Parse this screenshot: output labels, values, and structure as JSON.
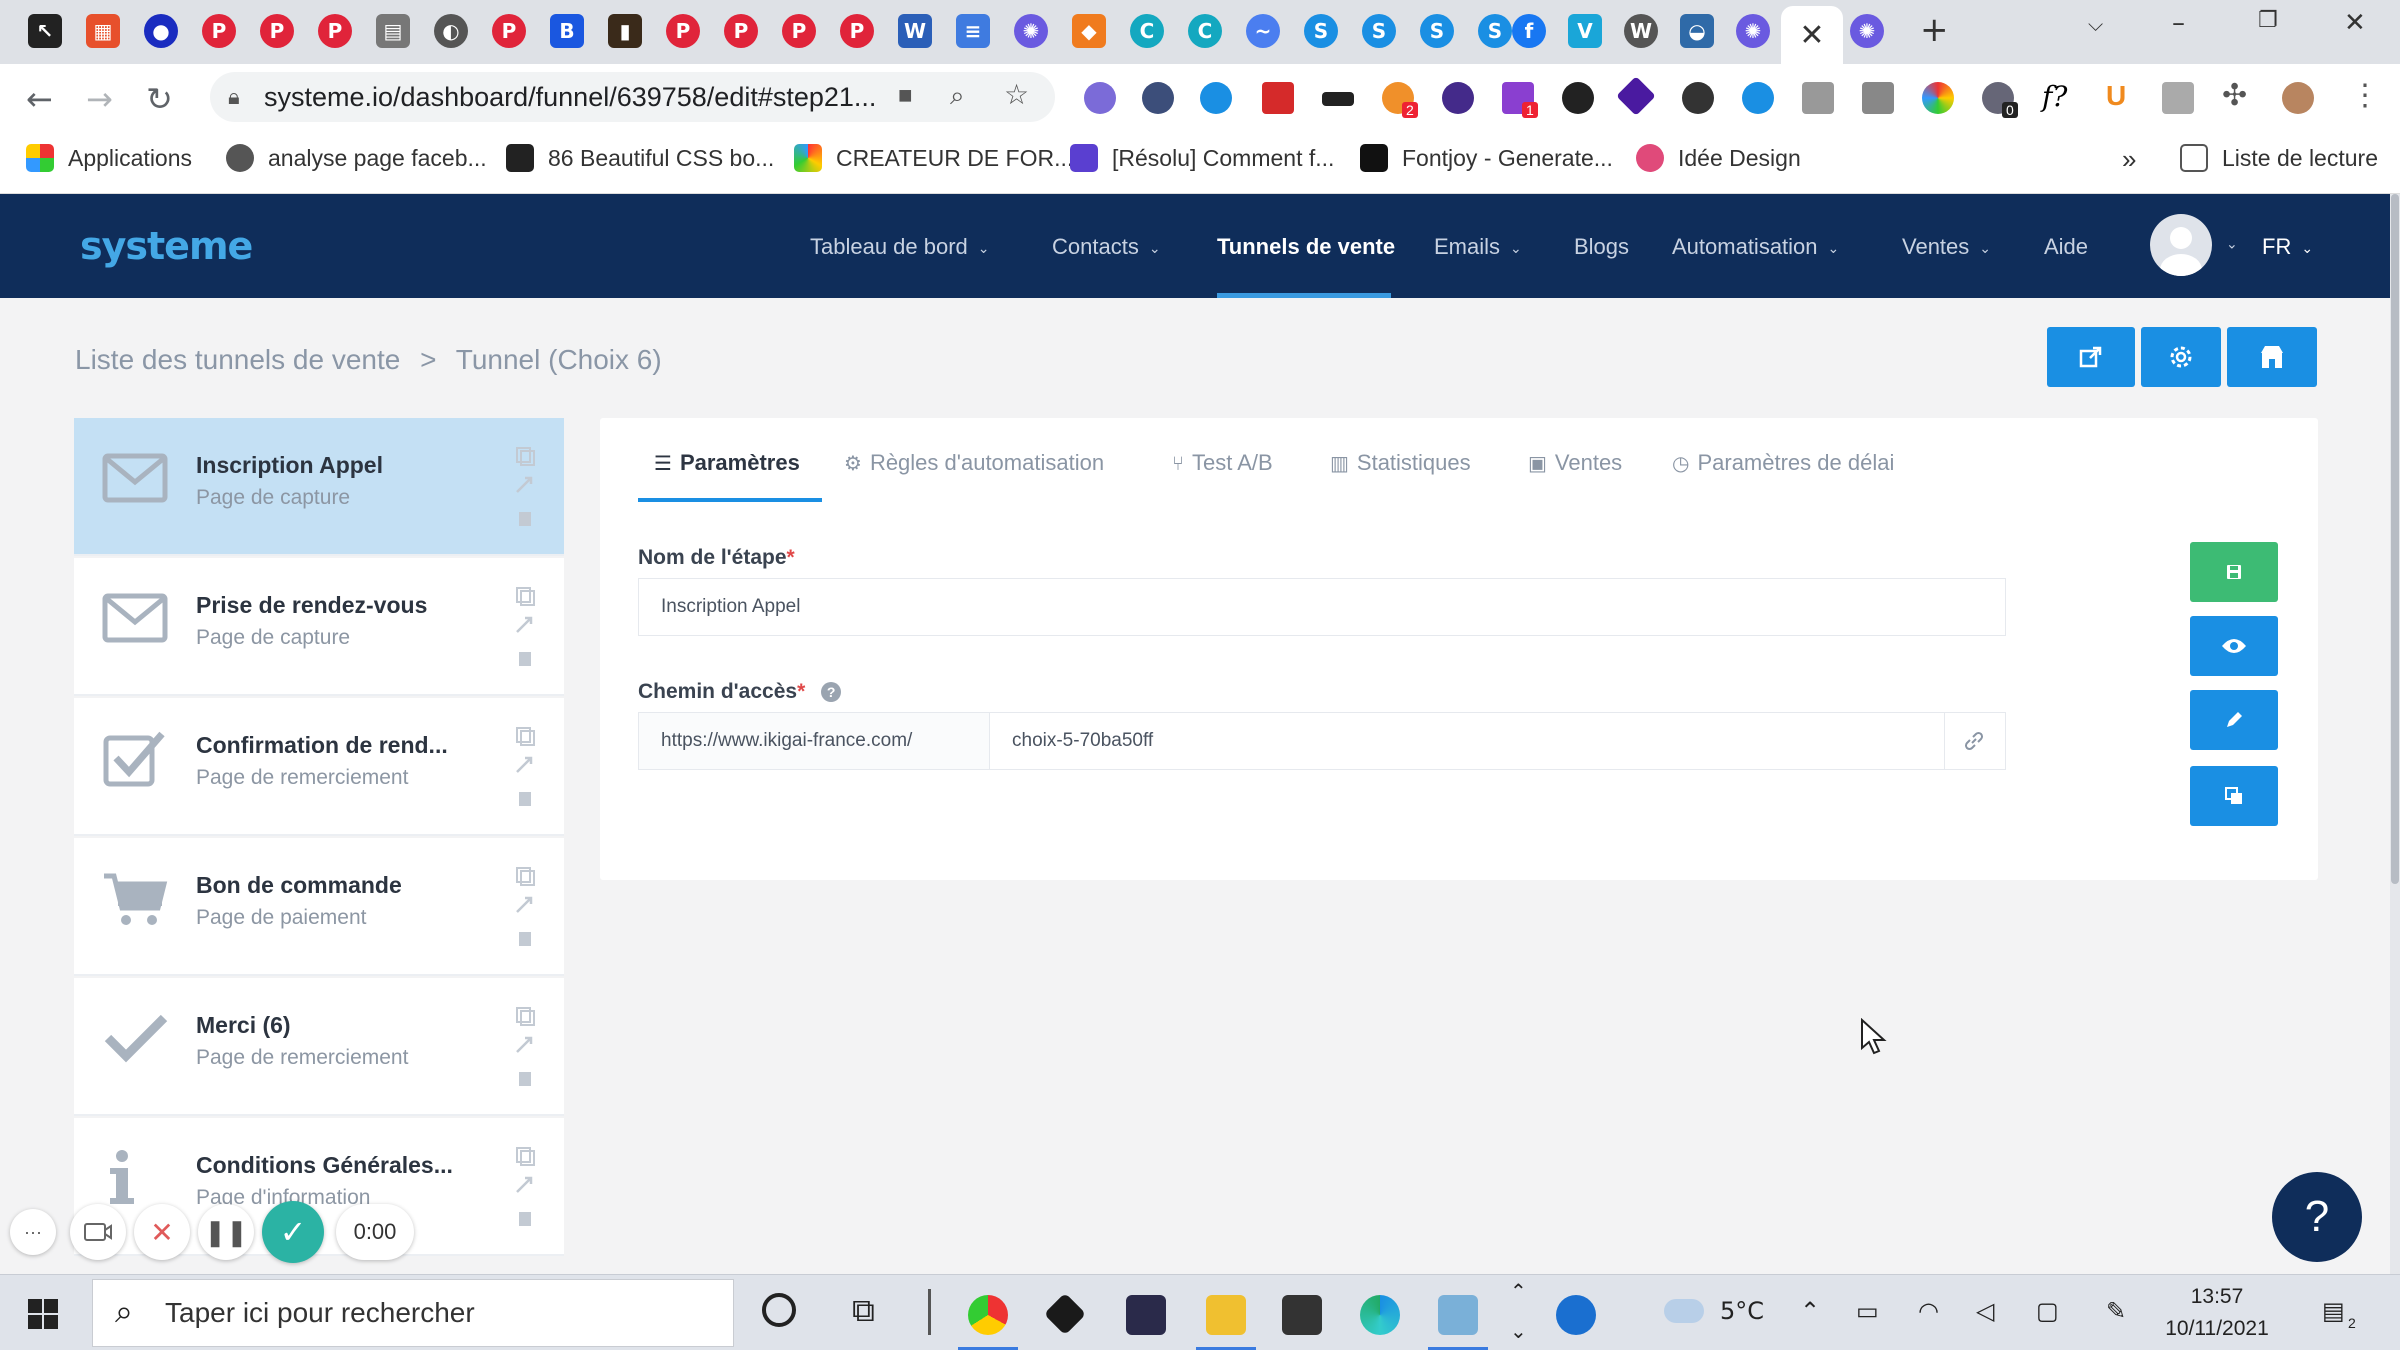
{
  "browser": {
    "url": "systeme.io/dashboard/funnel/639758/edit#step21...",
    "active_tab_close": "✕",
    "new_tab": "+",
    "bookmarks": [
      {
        "label": "Applications"
      },
      {
        "label": "analyse page faceb..."
      },
      {
        "label": "86 Beautiful CSS bo..."
      },
      {
        "label": "CREATEUR DE FOR..."
      },
      {
        "label": "[Résolu] Comment f..."
      },
      {
        "label": "Fontjoy - Generate..."
      },
      {
        "label": "Idée Design"
      }
    ],
    "bookmarks_more": "»",
    "reading_list": "Liste de lecture",
    "ext_badges": [
      "2",
      "1",
      "0"
    ]
  },
  "app": {
    "logo": "systeme",
    "nav": [
      {
        "label": "Tableau de bord",
        "caret": true
      },
      {
        "label": "Contacts",
        "caret": true
      },
      {
        "label": "Tunnels de vente",
        "caret": false,
        "active": true
      },
      {
        "label": "Emails",
        "caret": true
      },
      {
        "label": "Blogs",
        "caret": false
      },
      {
        "label": "Automatisation",
        "caret": true
      },
      {
        "label": "Ventes",
        "caret": true
      },
      {
        "label": "Aide",
        "caret": false
      }
    ],
    "language": "FR",
    "breadcrumb": {
      "root": "Liste des tunnels de vente",
      "sep": ">",
      "current": "Tunnel (Choix 6)"
    }
  },
  "steps": [
    {
      "title": "Inscription Appel",
      "subtitle": "Page de capture",
      "icon": "envelope-icon",
      "selected": true
    },
    {
      "title": "Prise de rendez-vous",
      "subtitle": "Page de capture",
      "icon": "envelope-icon"
    },
    {
      "title": "Confirmation de rend...",
      "subtitle": "Page de remerciement",
      "icon": "checkbox-icon"
    },
    {
      "title": "Bon de commande",
      "subtitle": "Page de paiement",
      "icon": "cart-icon"
    },
    {
      "title": "Merci (6)",
      "subtitle": "Page de remerciement",
      "icon": "check-icon"
    },
    {
      "title": "Conditions Générales...",
      "subtitle": "Page d'information",
      "icon": "info-icon"
    }
  ],
  "tabs": [
    {
      "label": "Paramètres",
      "icon": "☰",
      "active": true
    },
    {
      "label": "Règles d'automatisation",
      "icon": "⚙"
    },
    {
      "label": "Test A/B",
      "icon": "⑂"
    },
    {
      "label": "Statistiques",
      "icon": "▥"
    },
    {
      "label": "Ventes",
      "icon": "▣"
    },
    {
      "label": "Paramètres de délai",
      "icon": "◷"
    }
  ],
  "form": {
    "step_name_label": "Nom de l'étape",
    "step_name_value": "Inscription Appel",
    "path_label": "Chemin d'accès",
    "required_mark": "*",
    "help_mark": "?",
    "domain_prefix": "https://www.ikigai-france.com/",
    "path_value": "choix-5-70ba50ff"
  },
  "recorder": {
    "timer": "0:00",
    "more": "···"
  },
  "help_button": "?",
  "taskbar": {
    "search_placeholder": "Taper ici pour rechercher",
    "weather": "5°C",
    "time": "13:57",
    "date": "10/11/2021",
    "notif_count": "2"
  },
  "colors": {
    "nav_bg": "#0f2d5a",
    "accent": "#1a8fe3",
    "save_green": "#3dbb74",
    "selected_step": "#c4e0f4",
    "recorder_check": "#2bb3a4"
  }
}
